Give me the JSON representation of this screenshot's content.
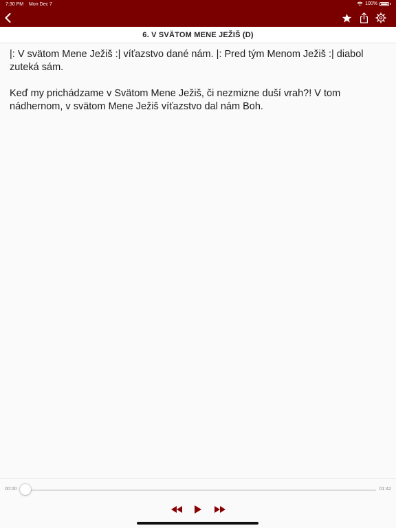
{
  "status_bar": {
    "time": "7:30 PM",
    "date": "Mon Dec 7",
    "battery": "100%"
  },
  "nav": {
    "back_icon": "chevron-left-icon",
    "actions": [
      "star-icon",
      "share-icon",
      "gear-icon"
    ]
  },
  "song": {
    "title": "6. V SVÄTOM MENE JEŽIŠ (D)",
    "paragraphs": [
      "|: V svätom Mene Ježiš :| víťazstvo dané nám. |: Pred tým Menom Ježiš :| diabol zuteká sám.",
      "Keď my prichádzame v Svätom Mene Ježiš, či nezmizne duší vrah?! V tom nádhernom, v svätom Mene Ježiš víťazstvo dal nám Boh."
    ]
  },
  "player": {
    "elapsed": "00:00",
    "duration": "01:42",
    "progress": 0,
    "controls": [
      "rewind-icon",
      "play-icon",
      "fast-forward-icon"
    ]
  },
  "colors": {
    "brand": "#7a0000",
    "accent": "#8a0000",
    "background": "#fafafa"
  }
}
